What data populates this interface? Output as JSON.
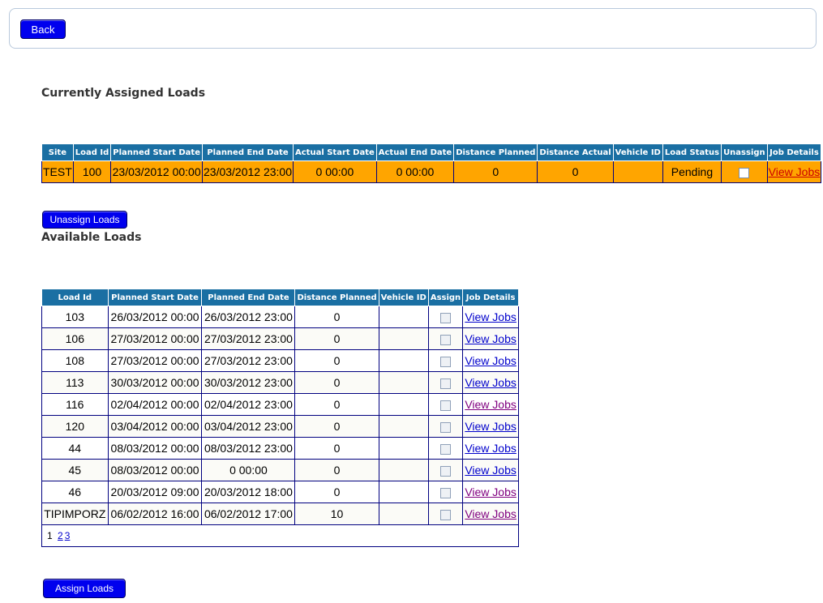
{
  "topbar": {
    "back_label": "Back"
  },
  "assigned": {
    "heading": "Currently Assigned Loads",
    "headers": [
      "Site",
      "Load Id",
      "Planned Start Date",
      "Planned End Date",
      "Actual Start Date",
      "Actual End Date",
      "Distance Planned",
      "Distance Actual",
      "Vehicle ID",
      "Load Status",
      "Unassign",
      "Job Details"
    ],
    "rows": [
      {
        "site": "TEST",
        "load_id": "100",
        "planned_start": "23/03/2012 00:00",
        "planned_end": "23/03/2012 23:00",
        "actual_start": "0 00:00",
        "actual_end": "0 00:00",
        "distance_planned": "0",
        "distance_actual": "0",
        "vehicle_id": "",
        "status": "Pending",
        "link": "View Jobs"
      }
    ],
    "button_label": "Unassign Loads"
  },
  "available": {
    "heading": "Available Loads",
    "headers": [
      "Load Id",
      "Planned Start Date",
      "Planned End Date",
      "Distance Planned",
      "Vehicle ID",
      "Assign",
      "Job Details"
    ],
    "rows": [
      {
        "load_id": "103",
        "planned_start": "26/03/2012 00:00",
        "planned_end": "26/03/2012 23:00",
        "distance_planned": "0",
        "vehicle_id": "",
        "link": "View Jobs"
      },
      {
        "load_id": "106",
        "planned_start": "27/03/2012 00:00",
        "planned_end": "27/03/2012 23:00",
        "distance_planned": "0",
        "vehicle_id": "",
        "link": "View Jobs"
      },
      {
        "load_id": "108",
        "planned_start": "27/03/2012 00:00",
        "planned_end": "27/03/2012 23:00",
        "distance_planned": "0",
        "vehicle_id": "",
        "link": "View Jobs"
      },
      {
        "load_id": "113",
        "planned_start": "30/03/2012 00:00",
        "planned_end": "30/03/2012 23:00",
        "distance_planned": "0",
        "vehicle_id": "",
        "link": "View Jobs"
      },
      {
        "load_id": "116",
        "planned_start": "02/04/2012 00:00",
        "planned_end": "02/04/2012 23:00",
        "distance_planned": "0",
        "vehicle_id": "",
        "link": "View Jobs"
      },
      {
        "load_id": "120",
        "planned_start": "03/04/2012 00:00",
        "planned_end": "03/04/2012 23:00",
        "distance_planned": "0",
        "vehicle_id": "",
        "link": "View Jobs"
      },
      {
        "load_id": "44",
        "planned_start": "08/03/2012 00:00",
        "planned_end": "08/03/2012 23:00",
        "distance_planned": "0",
        "vehicle_id": "",
        "link": "View Jobs"
      },
      {
        "load_id": "45",
        "planned_start": "08/03/2012 00:00",
        "planned_end": "0 00:00",
        "distance_planned": "0",
        "vehicle_id": "",
        "link": "View Jobs"
      },
      {
        "load_id": "46",
        "planned_start": "20/03/2012 09:00",
        "planned_end": "20/03/2012 18:00",
        "distance_planned": "0",
        "vehicle_id": "",
        "link": "View Jobs"
      },
      {
        "load_id": "TIPIMPORZ",
        "planned_start": "06/02/2012 16:00",
        "planned_end": "06/02/2012 17:00",
        "distance_planned": "10",
        "vehicle_id": "",
        "link": "View Jobs"
      }
    ],
    "pager": {
      "current": "1",
      "pages": [
        "2",
        "3"
      ]
    },
    "button_label": "Assign Loads"
  }
}
